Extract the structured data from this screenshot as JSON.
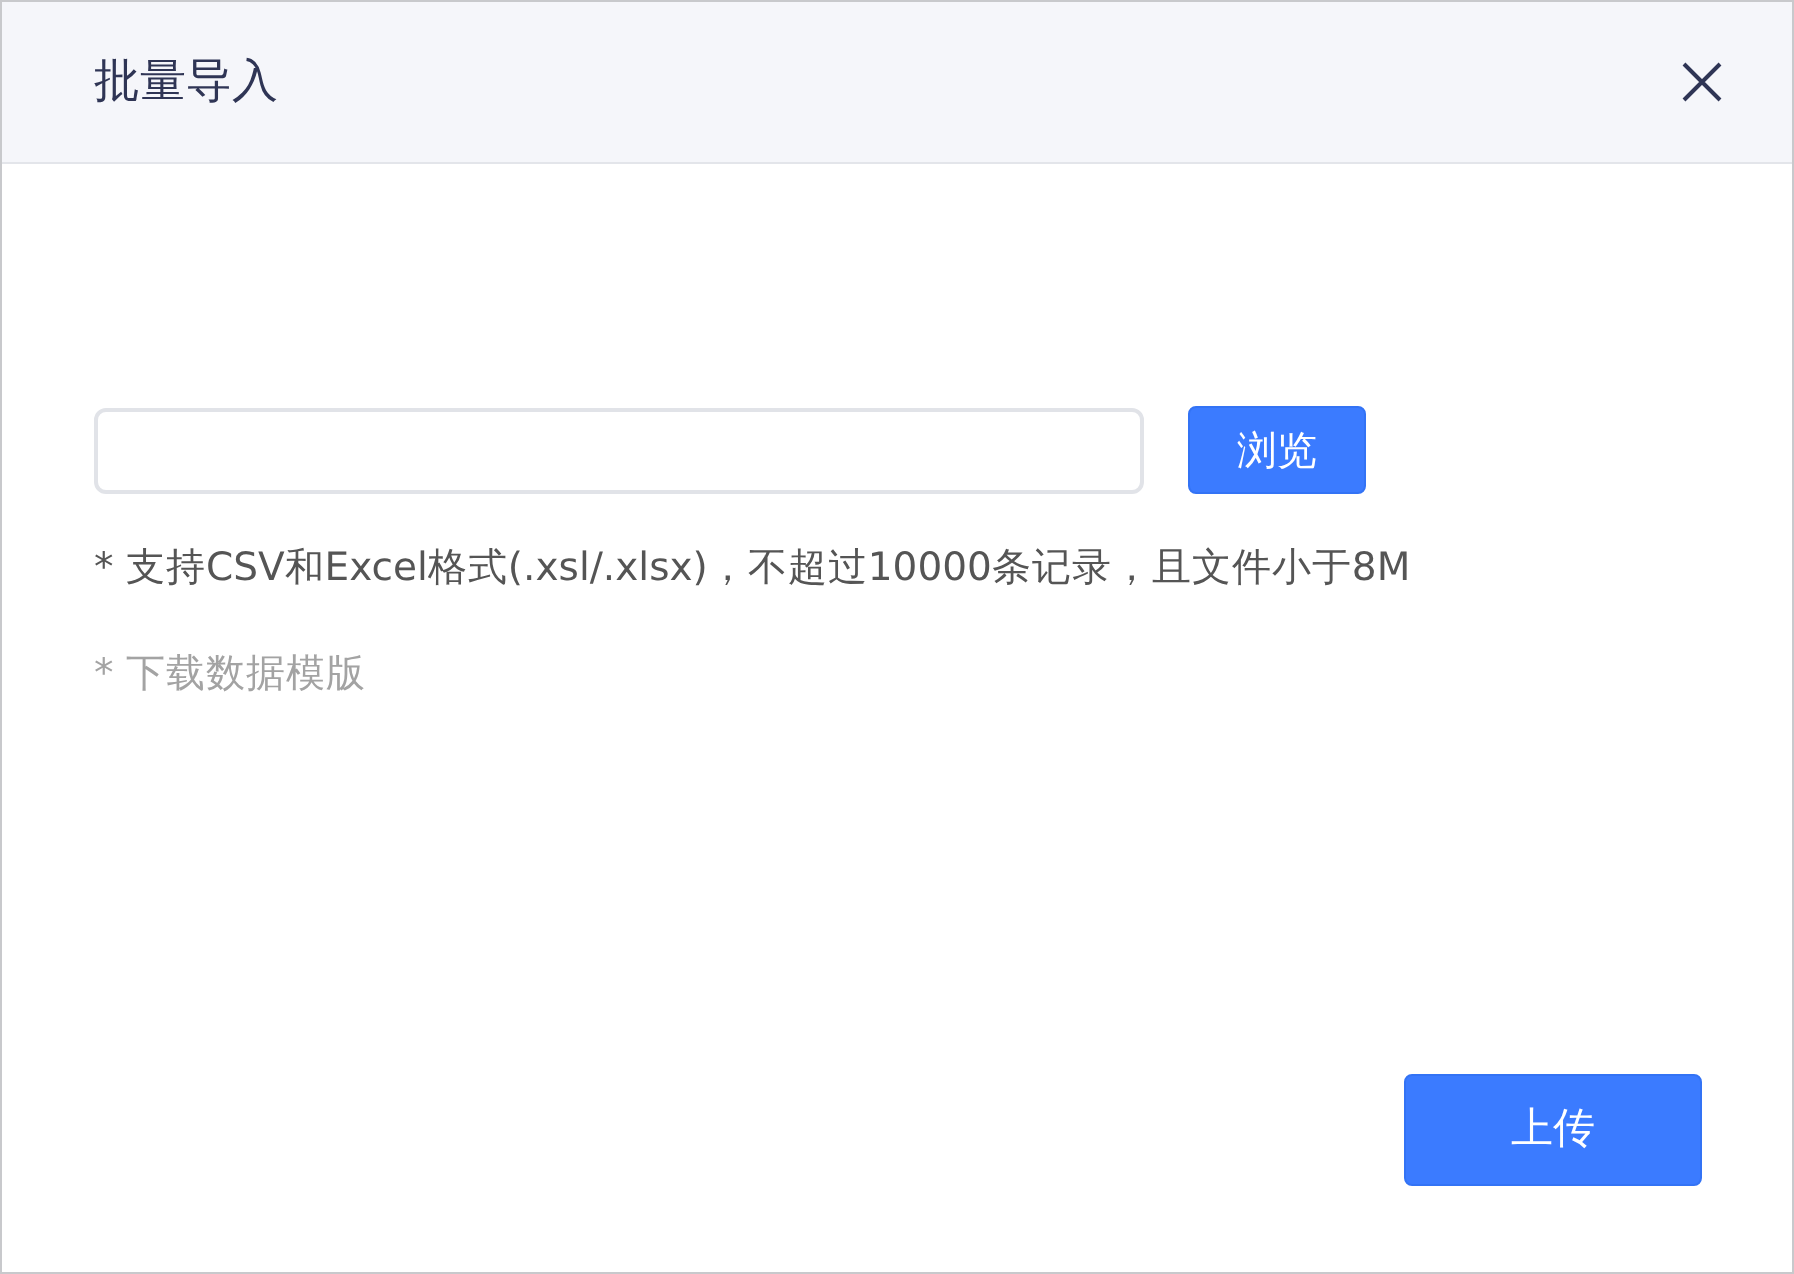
{
  "dialog": {
    "title": "批量导入"
  },
  "browse_button": "浏览",
  "hint": "* 支持CSV和Excel格式(.xsl/.xlsx)，不超过10000条记录，且文件小于8M",
  "template_link": "* 下载数据模版",
  "upload_button": "上传"
}
